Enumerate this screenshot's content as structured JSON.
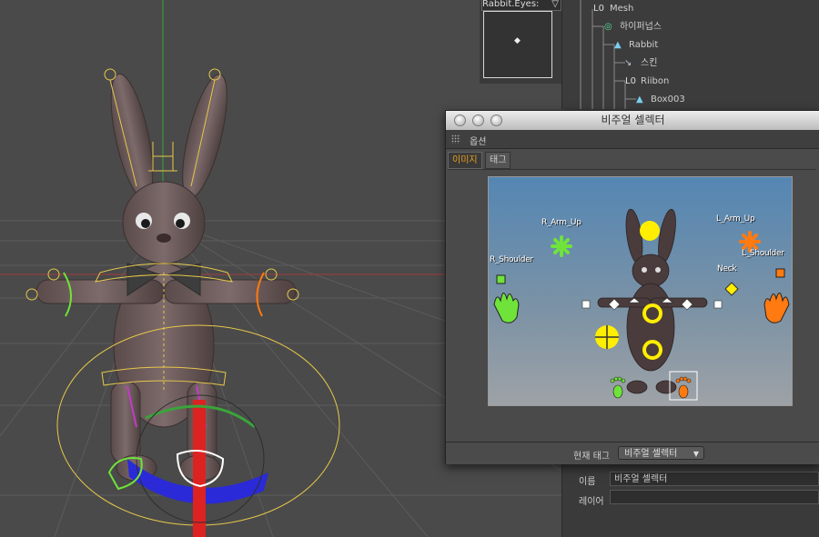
{
  "preview": {
    "title": "Rabbit.Eyes:"
  },
  "object_manager": {
    "items": [
      {
        "label": "Mesh",
        "icon": "null-object-icon"
      },
      {
        "label": "하이퍼넙스",
        "icon": "hypernurbs-icon"
      },
      {
        "label": "Rabbit",
        "icon": "polygon-object-icon"
      },
      {
        "label": "스킨",
        "icon": "skin-icon"
      },
      {
        "label": "Riibon",
        "icon": "null-object-icon"
      },
      {
        "label": "Box003",
        "icon": "polygon-object-icon"
      }
    ]
  },
  "visual_selector": {
    "title": "비주얼 셀렉터",
    "menu_options": "옵션",
    "tabs": [
      {
        "label": "이미지",
        "active": true
      },
      {
        "label": "태그",
        "active": false
      }
    ],
    "hotspot_labels": {
      "r_arm_up": "R_Arm_Up",
      "l_arm_up": "L_Arm_Up",
      "r_shoulder": "R_Shoulder",
      "l_shoulder": "L_Shoulder",
      "neck": "Neck"
    },
    "footer": {
      "current_tag_label": "현재 태그",
      "current_tag_value": "비주얼 셀렉터"
    }
  },
  "attributes": {
    "name_label": "이름",
    "name_value": "비주얼 셀렉터",
    "layer_label": "레이어",
    "layer_value": ""
  },
  "colors": {
    "accent_active_tab": "#e8a21a",
    "right_side": "#6fe33a",
    "left_side": "#ff7a10",
    "center": "#ffee00"
  }
}
